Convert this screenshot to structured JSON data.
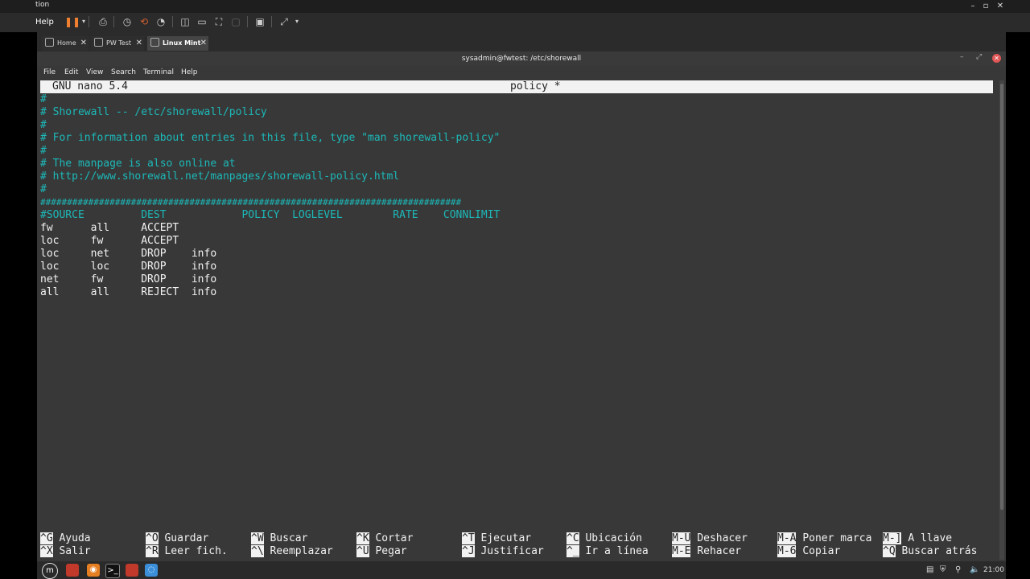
{
  "host": {
    "title": "tion",
    "help_menu": "Help"
  },
  "tabs": [
    {
      "label": "Home"
    },
    {
      "label": "PW Test"
    },
    {
      "label": "Linux Mint"
    }
  ],
  "window": {
    "title": "sysadmin@fwtest: /etc/shorewall",
    "menu": [
      "File",
      "Edit",
      "View",
      "Search",
      "Terminal",
      "Help"
    ]
  },
  "nano": {
    "version": "GNU nano 5.4",
    "filename": "policy *",
    "comment_lines": [
      "#",
      "# Shorewall -- /etc/shorewall/policy",
      "#",
      "# For information about entries in this file, type \"man shorewall-policy\"",
      "#",
      "# The manpage is also online at",
      "# http://www.shorewall.net/manpages/shorewall-policy.html",
      "#",
      "###############################################################################"
    ],
    "header_row": "#SOURCE         DEST            POLICY  LOGLEVEL        RATE    CONNLIMIT",
    "rows": [
      "fw      all     ACCEPT",
      "loc     fw      ACCEPT",
      "loc     net     DROP    info",
      "loc     loc     DROP    info",
      "net     fw      DROP    info",
      "all     all     REJECT  info"
    ],
    "shortcuts_row1": [
      {
        "key": "^G",
        "label": "Ayuda"
      },
      {
        "key": "^O",
        "label": "Guardar"
      },
      {
        "key": "^W",
        "label": "Buscar"
      },
      {
        "key": "^K",
        "label": "Cortar"
      },
      {
        "key": "^T",
        "label": "Ejecutar"
      },
      {
        "key": "^C",
        "label": "Ubicación"
      },
      {
        "key": "M-U",
        "label": "Deshacer"
      },
      {
        "key": "M-A",
        "label": "Poner marca"
      },
      {
        "key": "M-]",
        "label": "A llave"
      }
    ],
    "shortcuts_row2": [
      {
        "key": "^X",
        "label": "Salir"
      },
      {
        "key": "^R",
        "label": "Leer fich."
      },
      {
        "key": "^\\",
        "label": "Reemplazar"
      },
      {
        "key": "^U",
        "label": "Pegar"
      },
      {
        "key": "^J",
        "label": "Justificar"
      },
      {
        "key": "^_",
        "label": "Ir a línea"
      },
      {
        "key": "M-E",
        "label": "Rehacer"
      },
      {
        "key": "M-6",
        "label": "Copiar"
      },
      {
        "key": "^Q",
        "label": "Buscar atrás"
      }
    ]
  },
  "taskbar": {
    "clock": "21:00"
  }
}
